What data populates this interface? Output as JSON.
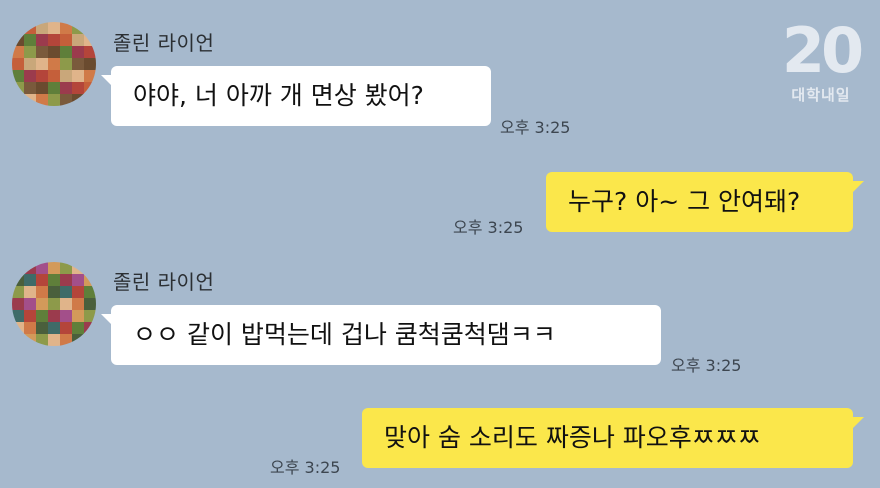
{
  "watermark": {
    "number": "20",
    "text": "대학내일"
  },
  "messages": [
    {
      "sender": "졸린 라이언",
      "text": "야야, 너 아까 개 면상 봤어?",
      "time": "오후 3:25",
      "direction": "incoming"
    },
    {
      "text": "누구? 아~ 그 안여돼?",
      "time": "오후 3:25",
      "direction": "outgoing"
    },
    {
      "sender": "졸린 라이언",
      "text": "ㅇㅇ 같이 밥먹는데 겁나 쿰척쿰척댐ㅋㅋ",
      "time": "오후 3:25",
      "direction": "incoming"
    },
    {
      "text": "맞아 숨 소리도 짜증나 파오후ㅉㅉㅉ",
      "time": "오후 3:25",
      "direction": "outgoing"
    }
  ],
  "colors": {
    "background": "#a6b9cd",
    "incoming_bubble": "#ffffff",
    "outgoing_bubble": "#fbe74b"
  }
}
